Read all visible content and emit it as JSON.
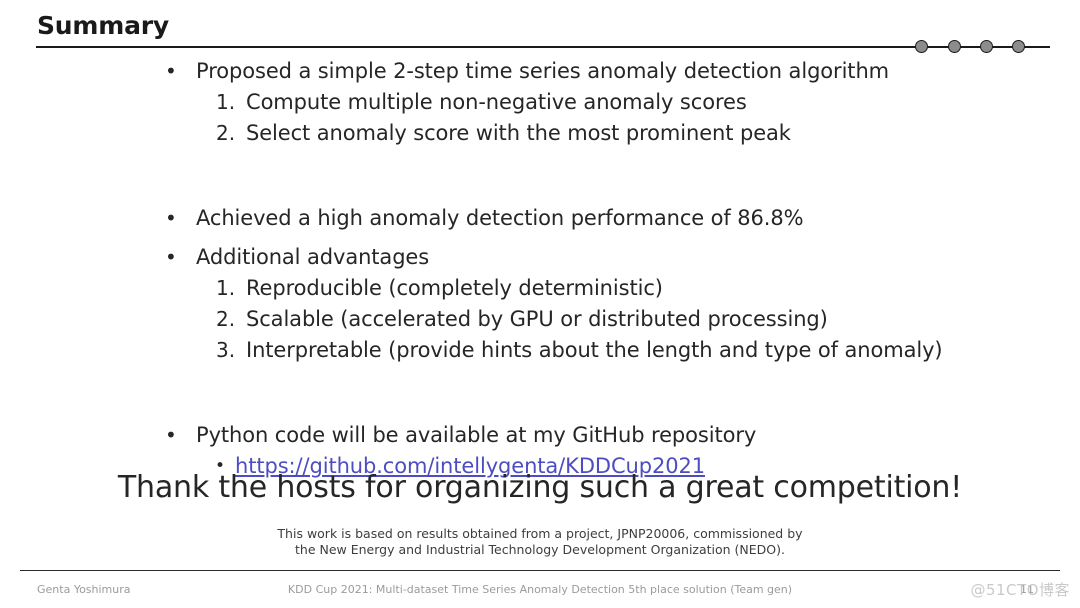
{
  "header": {
    "title": "Summary",
    "progress_dots": [
      {
        "name": "progress-dot-1"
      },
      {
        "name": "progress-dot-2"
      },
      {
        "name": "progress-dot-3"
      },
      {
        "name": "progress-dot-4"
      }
    ],
    "dot_fill_color": "#8c8c8c",
    "dot_border_color": "#1a1a1a",
    "rule_color": "#1a1a1a"
  },
  "body": {
    "bullet_glyph": "•",
    "blocks": [
      {
        "bullet": "Proposed a simple 2-step time series anomaly detection algorithm",
        "items": [
          {
            "marker": "1.",
            "text": "Compute multiple non-negative anomaly scores"
          },
          {
            "marker": "2.",
            "text": "Select anomaly score with the most prominent peak"
          }
        ]
      },
      {
        "bullet": "Achieved a high anomaly detection performance of 86.8%",
        "items": []
      },
      {
        "bullet": "Additional advantages",
        "items": [
          {
            "marker": "1.",
            "text": "Reproducible (completely deterministic)"
          },
          {
            "marker": "2.",
            "text": "Scalable (accelerated by GPU or distributed processing)"
          },
          {
            "marker": "3.",
            "text": "Interpretable (provide hints about the length and type of anomaly)"
          }
        ]
      },
      {
        "bullet": "Python code will be available at my GitHub repository",
        "link": {
          "text": "https://github.com/intellygenta/KDDCup2021",
          "color": "#4d4dc2"
        }
      }
    ]
  },
  "thanks": {
    "text": "Thank the hosts for organizing such a great competition!"
  },
  "acknowledgement": {
    "line1": "This work is based on results obtained from a project, JPNP20006, commissioned by",
    "line2": "the New Energy and Industrial Technology Development Organization (NEDO)."
  },
  "footer": {
    "author": "Genta Yoshimura",
    "subtitle": "KDD Cup 2021: Multi-dataset Time Series Anomaly Detection 5th place solution (Team gen)",
    "page_number": "11"
  },
  "watermark": {
    "text": "@51CTO博客"
  }
}
